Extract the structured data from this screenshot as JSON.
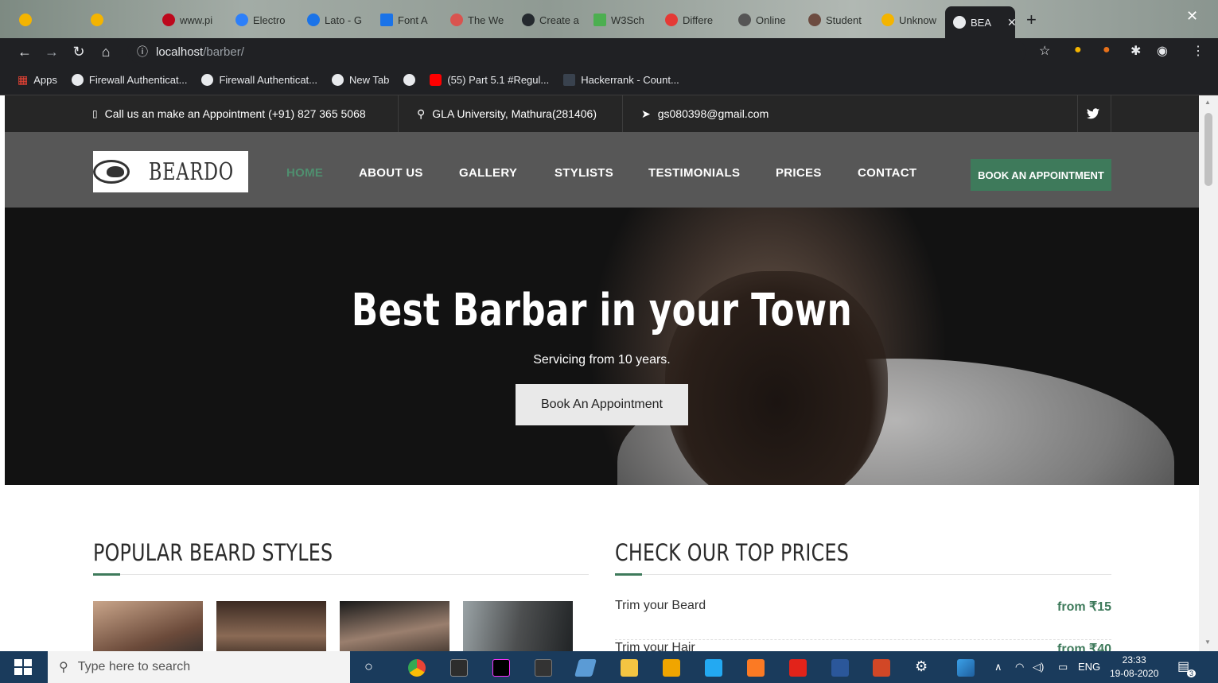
{
  "browser": {
    "tabs": [
      {
        "label": "",
        "color": "#f4b400"
      },
      {
        "label": "",
        "color": "#f4b400"
      },
      {
        "label": "www.pi",
        "color": "#bd081c"
      },
      {
        "label": "Electro",
        "color": "#2d7ff9"
      },
      {
        "label": "Lato - G",
        "color": "#1a73e8"
      },
      {
        "label": "Font A",
        "color": "#1a73e8"
      },
      {
        "label": "The We",
        "color": "#d9534f"
      },
      {
        "label": "Create a",
        "color": "#24292e"
      },
      {
        "label": "W3Sch",
        "color": "#4caf50"
      },
      {
        "label": "Differe",
        "color": "#e53935"
      },
      {
        "label": "Online",
        "color": "#555555"
      },
      {
        "label": "Student",
        "color": "#6d4c41"
      },
      {
        "label": "Unknow",
        "color": "#f4b400"
      }
    ],
    "active_tab": {
      "label": "BEA"
    },
    "url_host": "localhost",
    "url_path": "/barber/",
    "bookmarks": [
      {
        "label": "Apps"
      },
      {
        "label": "Firewall Authenticat..."
      },
      {
        "label": "Firewall Authenticat..."
      },
      {
        "label": "New Tab"
      },
      {
        "label": ""
      },
      {
        "label": "(55) Part 5.1 #Regul..."
      },
      {
        "label": "Hackerrank - Count..."
      }
    ]
  },
  "site": {
    "topbar": {
      "phone": "Call us an make an Appointment (+91) 827 365 5068",
      "address": "GLA University, Mathura(281406)",
      "email": "gs080398@gmail.com"
    },
    "logo_text": "BEARDO",
    "nav": [
      {
        "label": "HOME",
        "active": true
      },
      {
        "label": "ABOUT US"
      },
      {
        "label": "GALLERY"
      },
      {
        "label": "STYLISTS"
      },
      {
        "label": "TESTIMONIALS"
      },
      {
        "label": "PRICES"
      },
      {
        "label": "CONTACT"
      }
    ],
    "book_button": "BOOK AN APPOINTMENT",
    "hero": {
      "title": "Best Barbar in your Town",
      "subtitle": "Servicing from 10 years.",
      "button": "Book An Appointment"
    },
    "beard_styles_title": "POPULAR BEARD STYLES",
    "prices_title": "CHECK OUR TOP PRICES",
    "prices": [
      {
        "label": "Trim your Beard",
        "value": "from ₹15"
      },
      {
        "label": "Trim your Hair",
        "value": "from ₹40"
      }
    ]
  },
  "taskbar": {
    "search_placeholder": "Type here to search",
    "language": "ENG",
    "time": "23:33",
    "date": "19-08-2020",
    "notification_count": "3"
  },
  "colors": {
    "accent_green": "#3e7a5b",
    "topbar_bg": "#262626",
    "nav_bg": "#575757",
    "taskbar_bg": "#1a3b5c"
  }
}
